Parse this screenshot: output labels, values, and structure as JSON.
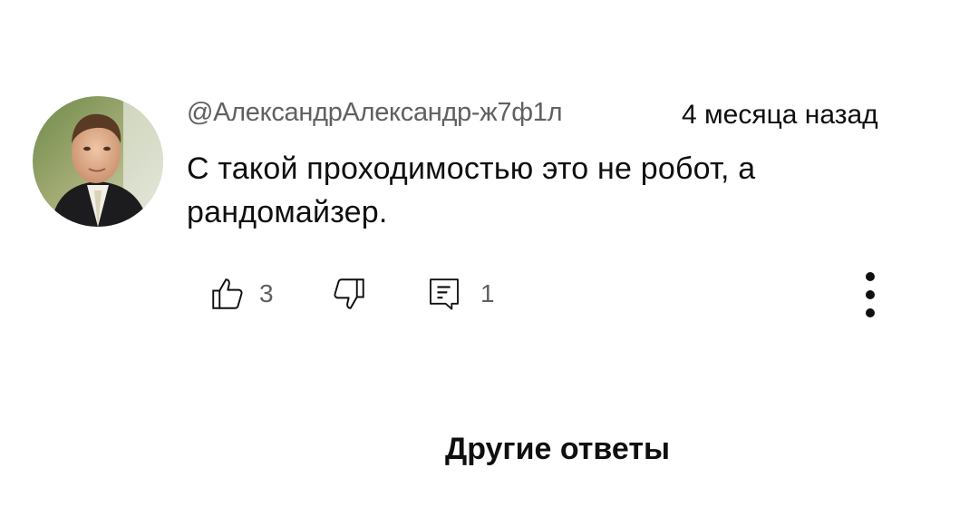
{
  "comment": {
    "author": "@АлександрАлександр-ж7ф1л",
    "time": "4 месяца назад",
    "text": "С такой проходимостью это не робот, а рандомайзер.",
    "avatar_icon": "user-avatar-photo"
  },
  "actions": {
    "like_icon": "thumb-up-icon",
    "like_count": "3",
    "dislike_icon": "thumb-down-icon",
    "reply_icon": "comment-reply-icon",
    "reply_count": "1",
    "menu_icon": "more-vertical-icon"
  },
  "more_replies_label": "Другие ответы",
  "colors": {
    "primary_text": "#0f0f0f",
    "secondary_text": "#606060",
    "background": "#ffffff"
  }
}
